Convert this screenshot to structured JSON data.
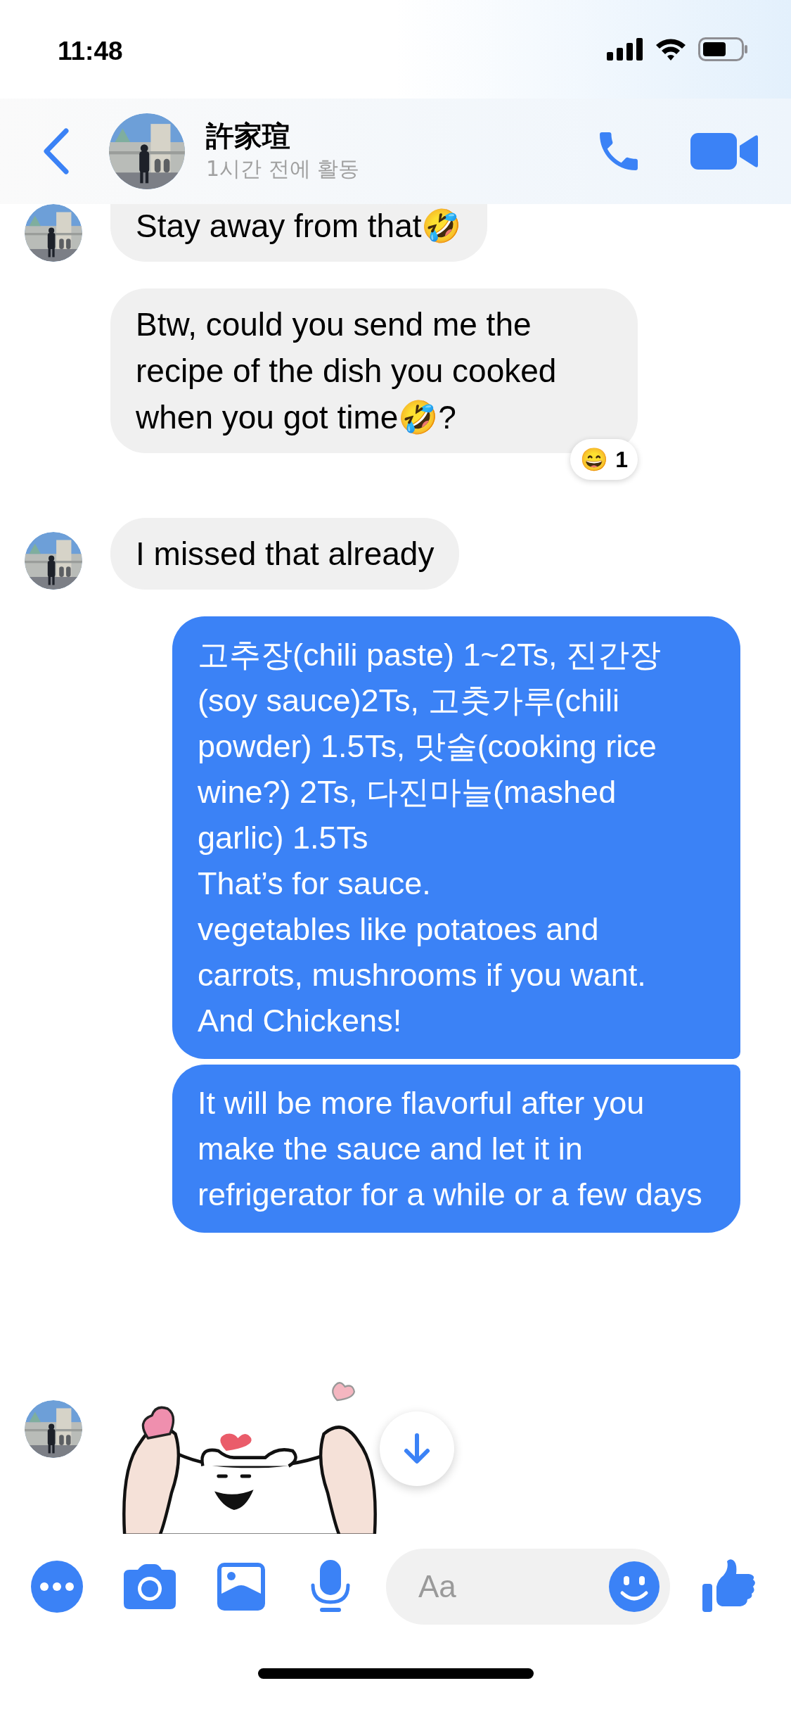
{
  "status_bar": {
    "time": "11:48"
  },
  "header": {
    "name": "許家瑄",
    "activity": "1시간 전에 활동"
  },
  "messages": [
    {
      "kind": "received",
      "text": "Stay away from that🤣",
      "avatar": true
    },
    {
      "kind": "received",
      "text": "Btw, could you send me the recipe of the dish you cooked when you got time🤣?",
      "avatar": false,
      "reaction": {
        "emoji": "😄",
        "count": "1"
      }
    },
    {
      "kind": "received",
      "text": "I missed that already",
      "avatar": true
    },
    {
      "kind": "sent",
      "text": "고추장(chili paste) 1~2Ts, 진간장(soy sauce)2Ts, 고춧가루(chili powder) 1.5Ts, 맛술(cooking rice wine?) 2Ts, 다진마늘(mashed garlic) 1.5Ts\nThat’s for sauce.\nvegetables like potatoes and carrots, mushrooms if you want. And Chickens!"
    },
    {
      "kind": "sent",
      "text": "It will be more flavorful after you make the sauce and let it in refrigerator for a while or a few days"
    },
    {
      "kind": "sticker",
      "avatar": true
    }
  ],
  "composer": {
    "placeholder": "Aa"
  }
}
